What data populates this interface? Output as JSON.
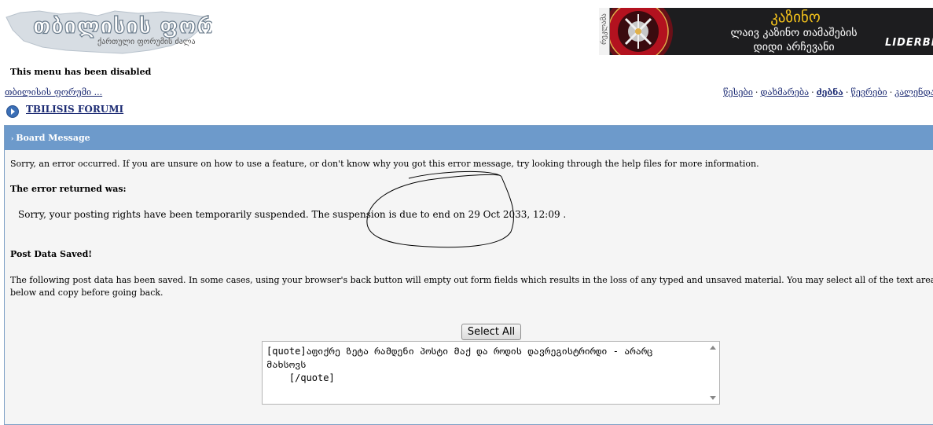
{
  "header": {
    "logo_title": "თბილისის ფორუმი",
    "logo_subtitle": "ქართული ფორუმის ძალა"
  },
  "banner": {
    "side_tag": "რეკლამა",
    "title": "კაზინო",
    "line1": "ლაივ კაზინო თამაშების",
    "line2": "დიდი არჩევანი",
    "brand": "LIDERBI"
  },
  "menu_disabled": "This menu has been disabled",
  "breadcrumb": "თბილისის ფორუმი ...",
  "top_links": [
    "წესები",
    "დახმარება",
    "ძებნა",
    "წევრები",
    "კალენდარი"
  ],
  "nav_title": "TBILISIS FORUMI",
  "board": {
    "header": "Board Message",
    "intro": "Sorry, an error occurred. If you are unsure on how to use a feature, or don't know why you got this error message, try looking through the help files for more information.",
    "error_label": "The error returned was:",
    "error_text": "Sorry, your posting rights have been temporarily suspended. The suspension is due to end on 29 Oct 2033, 12:09 .",
    "saved_label": "Post Data Saved!",
    "saved_text": "The following post data has been saved. In some cases, using your browser's back button will empty out form fields which results in the loss of any typed and unsaved material. You may select all of the text area below and copy before going back.",
    "select_all": "Select All",
    "post_text": "[quote]აფიქრე ზეტა რამდენი პოსტი მაქ და როდის დავრეგისტრირდი - არარც მახსოვს\n    [/quote]"
  },
  "colors": {
    "header_bar": "#6d9acb",
    "link": "#1c2b73",
    "banner_gold": "#f3c21b",
    "annotation": "#000000"
  }
}
